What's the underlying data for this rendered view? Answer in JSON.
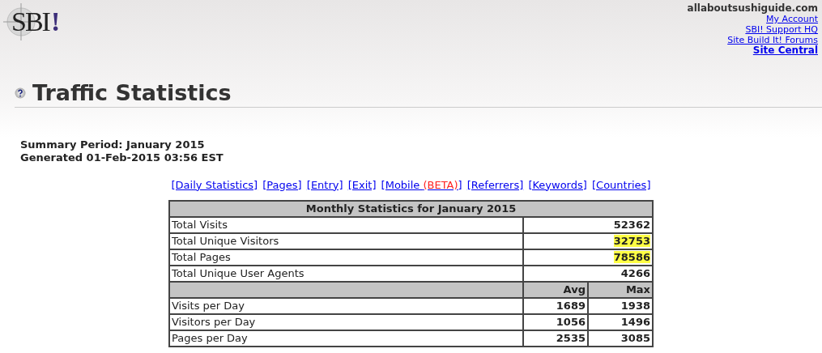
{
  "logo": {
    "text": "SBI",
    "mark": "!"
  },
  "account": {
    "site": "allaboutsushiguide.com",
    "links": [
      {
        "label": "My Account",
        "bold": false
      },
      {
        "label": "SBI! Support HQ",
        "bold": false
      },
      {
        "label": "Site Build It! Forums",
        "bold": false
      },
      {
        "label": "Site Central",
        "bold": true
      }
    ]
  },
  "title": "Traffic Statistics",
  "summary": [
    "Summary Period: January 2015",
    "Generated 01-Feb-2015 03:56 EST"
  ],
  "nav_links": [
    {
      "label": "[Daily Statistics]"
    },
    {
      "label": "[Pages]"
    },
    {
      "label": "[Entry]"
    },
    {
      "label": "[Exit]"
    },
    {
      "label": "[Mobile ",
      "note": "(BETA)",
      "suffix": "]"
    },
    {
      "label": "[Referrers]"
    },
    {
      "label": "[Keywords]"
    },
    {
      "label": "[Countries]"
    }
  ],
  "table": {
    "title": "Monthly Statistics for January 2015",
    "totals": [
      {
        "label": "Total Visits",
        "value": "52362",
        "highlighted": false
      },
      {
        "label": "Total Unique Visitors",
        "value": "32753",
        "highlighted": true
      },
      {
        "label": "Total Pages",
        "value": "78586",
        "highlighted": true
      },
      {
        "label": "Total Unique User Agents",
        "value": "4266",
        "highlighted": false
      }
    ],
    "columns": [
      "Avg",
      "Max"
    ],
    "rows": [
      {
        "label": "Visits per Day",
        "avg": "1689",
        "max": "1938"
      },
      {
        "label": "Visitors per Day",
        "avg": "1056",
        "max": "1496"
      },
      {
        "label": "Pages per Day",
        "avg": "2535",
        "max": "3085"
      }
    ]
  }
}
